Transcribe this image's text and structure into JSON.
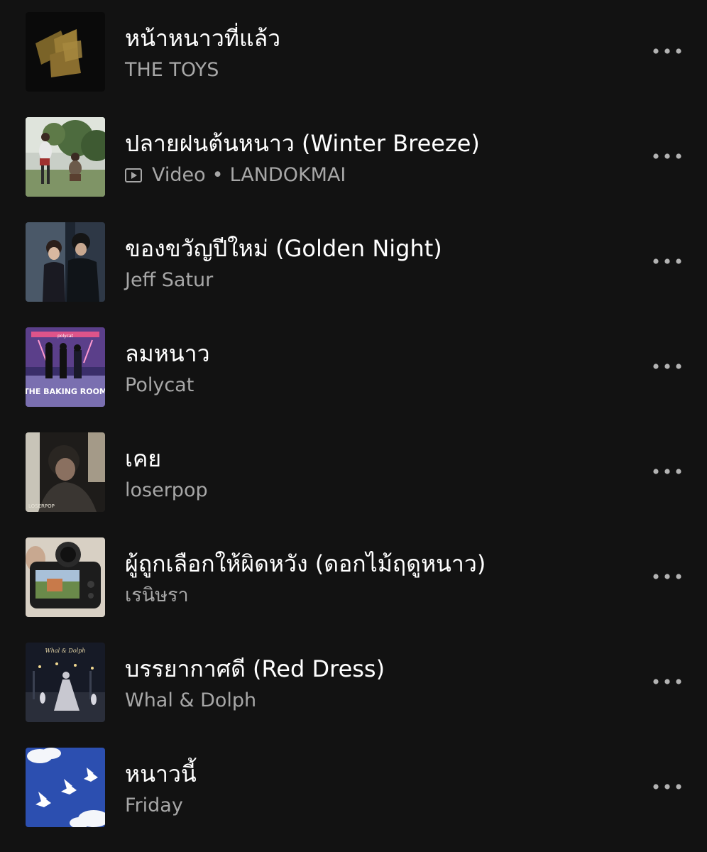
{
  "tracks": [
    {
      "title": "หน้าหนาวที่แล้ว",
      "artist": "THE TOYS",
      "is_video": false,
      "cover": "folded-paper-cover"
    },
    {
      "title": "ปลายฝนต้นหนาว (Winter Breeze)",
      "artist": "LANDOKMAI",
      "is_video": true,
      "type_label": "Video",
      "separator": "•",
      "cover": "outdoor-couple-cover"
    },
    {
      "title": "ของขวัญปีใหม่ (Golden Night)",
      "artist": "Jeff Satur",
      "is_video": false,
      "cover": "couple-night-cover"
    },
    {
      "title": "ลมหนาว",
      "artist": "Polycat",
      "is_video": false,
      "cover": "baking-room-cover"
    },
    {
      "title": "เคย",
      "artist": "loserpop",
      "is_video": false,
      "cover": "loserpop-portrait-cover"
    },
    {
      "title": "ผู้ถูกเลือกให้ผิดหวัง (ดอกไม้ฤดูหนาว)",
      "artist": "เรนิษรา",
      "is_video": false,
      "cover": "camera-cover"
    },
    {
      "title": "บรรยากาศดี (Red Dress)",
      "artist": "Whal & Dolph",
      "is_video": false,
      "cover": "night-street-cover"
    },
    {
      "title": "หนาวนี้",
      "artist": "Friday",
      "is_video": false,
      "cover": "birds-sky-cover"
    }
  ],
  "cover_logos": {
    "baking_room": "THE BAKING ROOM",
    "polycat": "polycat",
    "loserpop": "LOSERPOP",
    "whal_dolph": "Whal & Dolph"
  },
  "icons": {
    "more": "more-horizontal-icon",
    "video": "video-play-icon"
  },
  "colors": {
    "background": "#121212",
    "title": "#ffffff",
    "subtitle": "#a7a7a7",
    "more_dots": "#b3b3b3"
  }
}
